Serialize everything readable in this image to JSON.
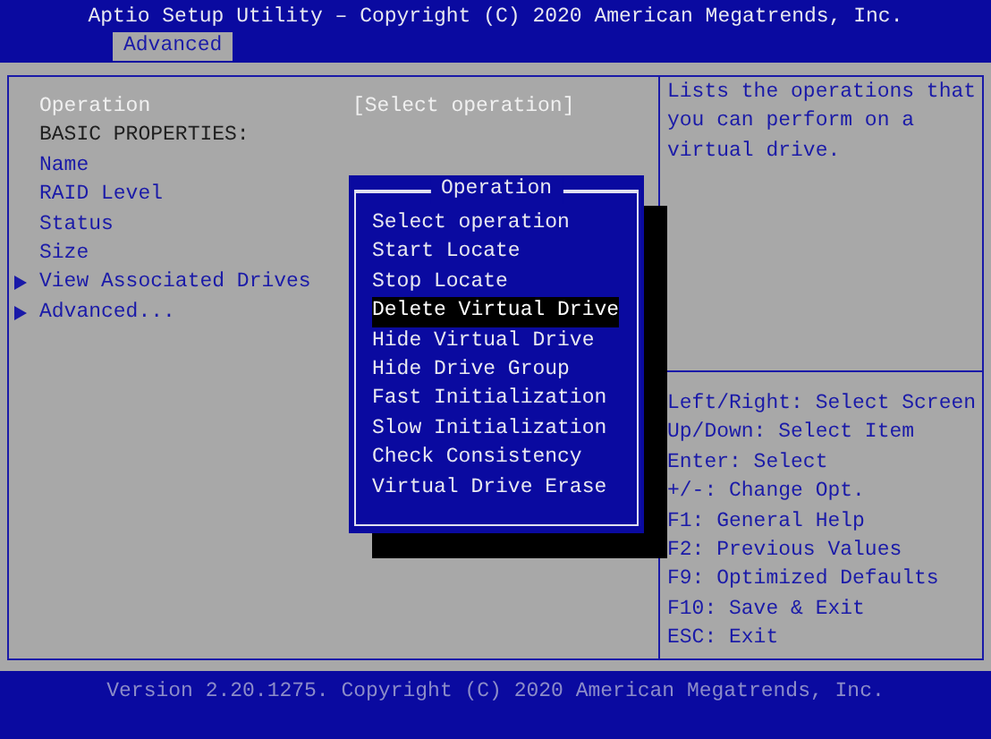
{
  "header": {
    "title": "Aptio Setup Utility – Copyright (C) 2020 American Megatrends, Inc."
  },
  "tabs": [
    {
      "label": "Advanced",
      "selected": true
    }
  ],
  "main": {
    "items": [
      {
        "kind": "option",
        "label": "Operation",
        "value": "[Select operation]",
        "selected": true
      },
      {
        "kind": "heading",
        "label": "BASIC PROPERTIES:"
      },
      {
        "kind": "info",
        "label": "Name"
      },
      {
        "kind": "info",
        "label": "RAID Level"
      },
      {
        "kind": "info",
        "label": "Status"
      },
      {
        "kind": "info",
        "label": "Size"
      },
      {
        "kind": "submenu",
        "label": "View Associated Drives"
      },
      {
        "kind": "submenu",
        "label": "Advanced..."
      }
    ]
  },
  "help": {
    "description": "Lists the operations that you can perform on a virtual drive.",
    "keys": [
      "Left/Right: Select Screen",
      "Up/Down: Select Item",
      "Enter: Select",
      "+/-: Change Opt.",
      "F1: General Help",
      "F2: Previous Values",
      "F9: Optimized Defaults",
      "F10: Save & Exit",
      "ESC: Exit"
    ]
  },
  "popup": {
    "title": "Operation",
    "options": [
      {
        "label": "Select operation",
        "selected": false
      },
      {
        "label": "Start Locate",
        "selected": false
      },
      {
        "label": "Stop Locate",
        "selected": false
      },
      {
        "label": "Delete Virtual Drive",
        "selected": true
      },
      {
        "label": "Hide Virtual Drive",
        "selected": false
      },
      {
        "label": "Hide Drive Group",
        "selected": false
      },
      {
        "label": "Fast Initialization",
        "selected": false
      },
      {
        "label": "Slow Initialization",
        "selected": false
      },
      {
        "label": "Check Consistency",
        "selected": false
      },
      {
        "label": "Virtual Drive Erase",
        "selected": false
      }
    ]
  },
  "footer": {
    "text": "Version 2.20.1275. Copyright (C) 2020 American Megatrends, Inc."
  }
}
